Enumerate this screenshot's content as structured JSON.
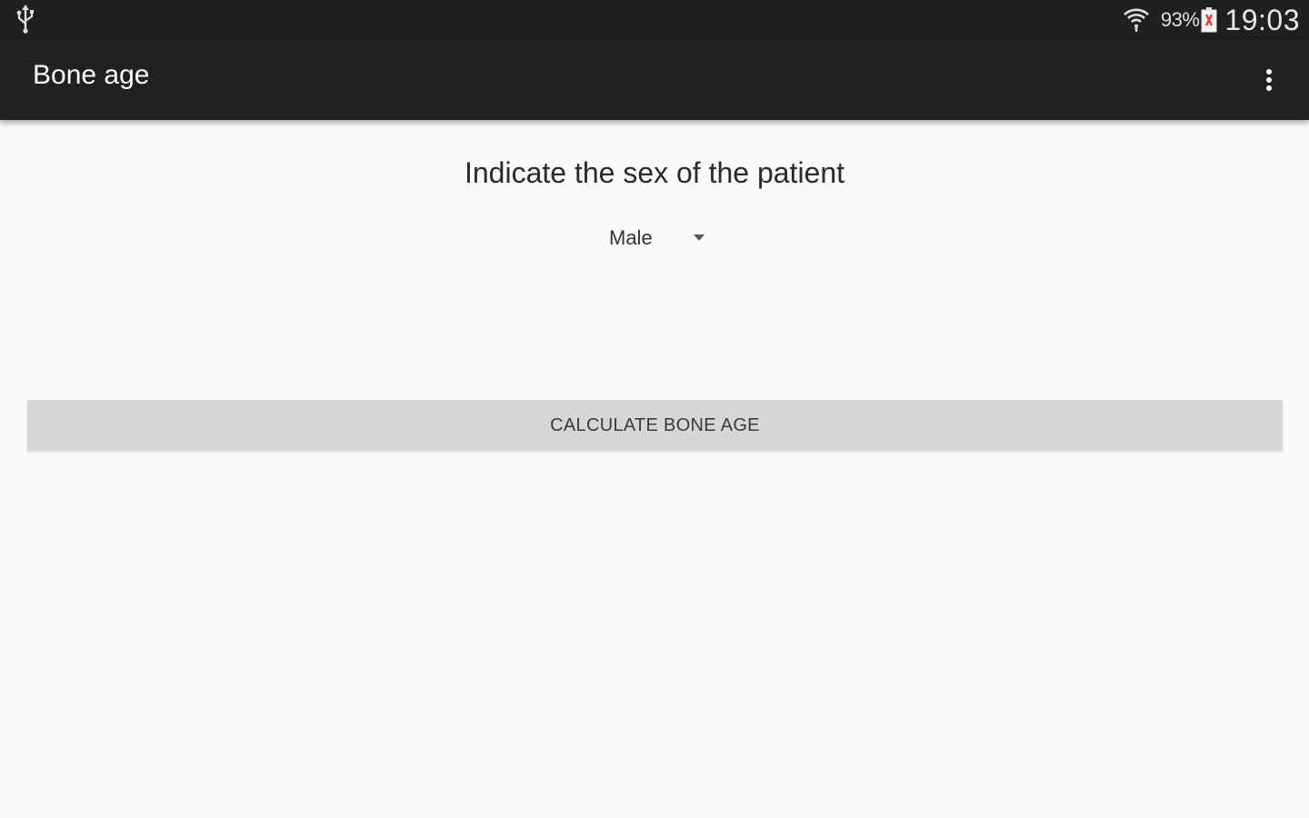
{
  "status_bar": {
    "battery_percent": "93%",
    "time": "19:03",
    "icons": [
      "usb-icon",
      "wifi-icon",
      "battery-charging-icon"
    ]
  },
  "app_bar": {
    "title": "Bone age",
    "menu_icon": "more-vertical-icon"
  },
  "main": {
    "prompt": "Indicate the sex of the patient",
    "sex_selector": {
      "selected": "Male"
    },
    "calculate_button_label": "CALCULATE BONE AGE"
  },
  "colors": {
    "app_bar": "#212121",
    "background": "#fafafa",
    "button": "#d5d6d6",
    "battery_accent": "#e53935"
  }
}
